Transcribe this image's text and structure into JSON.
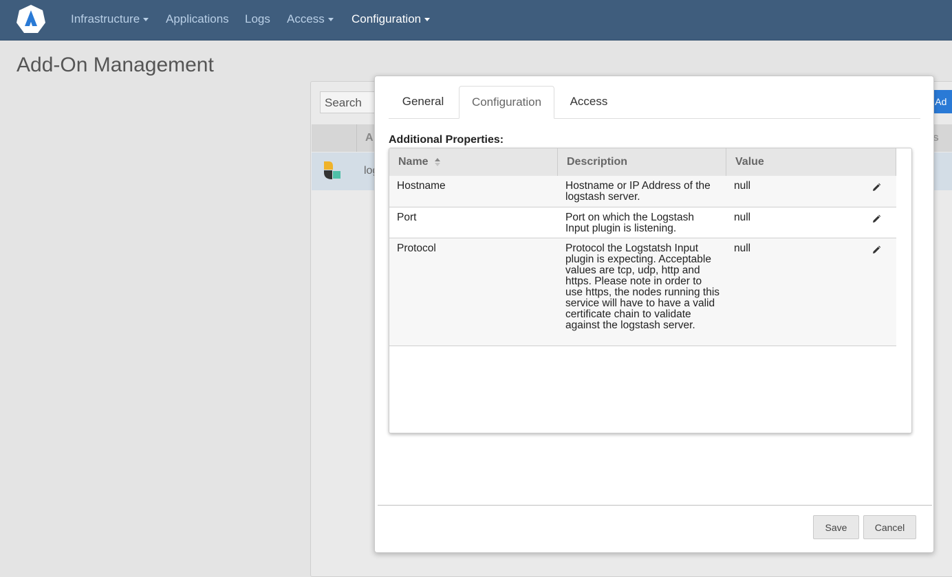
{
  "navbar": {
    "items": [
      {
        "label": "Infrastructure",
        "dropdown": true
      },
      {
        "label": "Applications",
        "dropdown": false
      },
      {
        "label": "Logs",
        "dropdown": false
      },
      {
        "label": "Access",
        "dropdown": true
      },
      {
        "label": "Configuration",
        "dropdown": true,
        "active": true
      }
    ]
  },
  "page": {
    "title": "Add-On Management"
  },
  "background": {
    "search_label": "Search",
    "header_partial": "A",
    "header_right_partial": "s",
    "row_text_partial": "log",
    "button_partial": "w Ad"
  },
  "modal": {
    "tabs": [
      {
        "label": "General",
        "active": false
      },
      {
        "label": "Configuration",
        "active": true
      },
      {
        "label": "Access",
        "active": false
      }
    ],
    "section_label": "Additional Properties:",
    "grid": {
      "columns": [
        "Name",
        "Description",
        "Value"
      ],
      "rows": [
        {
          "name": "Hostname",
          "description": "Hostname or IP Address of the logstash server.",
          "value": "null"
        },
        {
          "name": "Port",
          "description": "Port on which the Logstash Input plugin is listening.",
          "value": "null"
        },
        {
          "name": "Protocol",
          "description": "Protocol the Logstatsh Input plugin is expecting. Acceptable values are tcp, udp, http and https. Please note in order to use https, the nodes running this service will have to have a valid certificate chain to validate against the logstash server.",
          "value": "null"
        }
      ]
    },
    "buttons": {
      "save": "Save",
      "cancel": "Cancel"
    }
  },
  "colors": {
    "navbar": "#3f5d7d",
    "nav_text": "#b9cfe6",
    "primary_button": "#2a7ad6"
  }
}
